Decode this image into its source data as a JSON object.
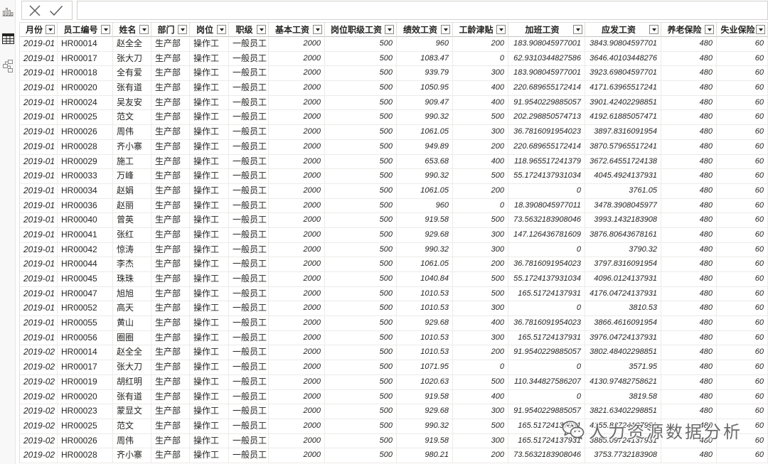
{
  "sidebar": {
    "items": [
      {
        "icon": "report-view-icon",
        "selected": false
      },
      {
        "icon": "data-view-icon",
        "selected": true
      },
      {
        "icon": "model-view-icon",
        "selected": false
      }
    ]
  },
  "formula_bar": {
    "cancel_icon": "close-icon",
    "commit_icon": "check-icon",
    "value": ""
  },
  "table": {
    "columns": [
      {
        "label": "月份"
      },
      {
        "label": "员工编号"
      },
      {
        "label": "姓名"
      },
      {
        "label": "部门"
      },
      {
        "label": "岗位"
      },
      {
        "label": "职级"
      },
      {
        "label": "基本工资"
      },
      {
        "label": "岗位职级工资"
      },
      {
        "label": "绩效工资"
      },
      {
        "label": "工龄津贴"
      },
      {
        "label": "加班工资"
      },
      {
        "label": "应发工资"
      },
      {
        "label": "养老保险"
      },
      {
        "label": "失业保险"
      }
    ],
    "rows": [
      [
        "2019-01",
        "HR00014",
        "赵全全",
        "生产部",
        "操作工",
        "一般员工",
        2000,
        500,
        960,
        200,
        183.908045977001,
        3843.90804597701,
        480,
        60
      ],
      [
        "2019-01",
        "HR00017",
        "张大刀",
        "生产部",
        "操作工",
        "一般员工",
        2000,
        500,
        1083.47,
        0,
        62.9310344827586,
        3646.40103448276,
        480,
        60
      ],
      [
        "2019-01",
        "HR00018",
        "全有爱",
        "生产部",
        "操作工",
        "一般员工",
        2000,
        500,
        939.79,
        300,
        183.908045977001,
        3923.69804597701,
        480,
        60
      ],
      [
        "2019-01",
        "HR00020",
        "张有道",
        "生产部",
        "操作工",
        "一般员工",
        2000,
        500,
        1050.95,
        400,
        220.689655172414,
        4171.63965517241,
        480,
        60
      ],
      [
        "2019-01",
        "HR00024",
        "吴友安",
        "生产部",
        "操作工",
        "一般员工",
        2000,
        500,
        909.47,
        400,
        91.9540229885057,
        3901.42402298851,
        480,
        60
      ],
      [
        "2019-01",
        "HR00025",
        "范文",
        "生产部",
        "操作工",
        "一般员工",
        2000,
        500,
        990.32,
        500,
        202.298850574713,
        4192.61885057471,
        480,
        60
      ],
      [
        "2019-01",
        "HR00026",
        "周伟",
        "生产部",
        "操作工",
        "一般员工",
        2000,
        500,
        1061.05,
        300,
        36.7816091954023,
        3897.8316091954,
        480,
        60
      ],
      [
        "2019-01",
        "HR00028",
        "齐小寨",
        "生产部",
        "操作工",
        "一般员工",
        2000,
        500,
        949.89,
        200,
        220.689655172414,
        3870.57965517241,
        480,
        60
      ],
      [
        "2019-01",
        "HR00029",
        "施工",
        "生产部",
        "操作工",
        "一般员工",
        2000,
        500,
        653.68,
        400,
        118.965517241379,
        3672.64551724138,
        480,
        60
      ],
      [
        "2019-01",
        "HR00033",
        "万峰",
        "生产部",
        "操作工",
        "一般员工",
        2000,
        500,
        990.32,
        500,
        55.1724137931034,
        4045.4924137931,
        480,
        60
      ],
      [
        "2019-01",
        "HR00034",
        "赵娟",
        "生产部",
        "操作工",
        "一般员工",
        2000,
        500,
        1061.05,
        200,
        0,
        3761.05,
        480,
        60
      ],
      [
        "2019-01",
        "HR00036",
        "赵丽",
        "生产部",
        "操作工",
        "一般员工",
        2000,
        500,
        960,
        0,
        18.3908045977011,
        3478.3908045977,
        480,
        60
      ],
      [
        "2019-01",
        "HR00040",
        "曾英",
        "生产部",
        "操作工",
        "一般员工",
        2000,
        500,
        919.58,
        500,
        73.5632183908046,
        3993.1432183908,
        480,
        60
      ],
      [
        "2019-01",
        "HR00041",
        "张红",
        "生产部",
        "操作工",
        "一般员工",
        2000,
        500,
        929.68,
        300,
        147.126436781609,
        3876.80643678161,
        480,
        60
      ],
      [
        "2019-01",
        "HR00042",
        "惊涛",
        "生产部",
        "操作工",
        "一般员工",
        2000,
        500,
        990.32,
        300,
        0,
        3790.32,
        480,
        60
      ],
      [
        "2019-01",
        "HR00044",
        "李杰",
        "生产部",
        "操作工",
        "一般员工",
        2000,
        500,
        1061.05,
        200,
        36.7816091954023,
        3797.8316091954,
        480,
        60
      ],
      [
        "2019-01",
        "HR00045",
        "珠珠",
        "生产部",
        "操作工",
        "一般员工",
        2000,
        500,
        1040.84,
        500,
        55.1724137931034,
        4096.0124137931,
        480,
        60
      ],
      [
        "2019-01",
        "HR00047",
        "旭旭",
        "生产部",
        "操作工",
        "一般员工",
        2000,
        500,
        1010.53,
        500,
        165.51724137931,
        4176.04724137931,
        480,
        60
      ],
      [
        "2019-01",
        "HR00052",
        "高天",
        "生产部",
        "操作工",
        "一般员工",
        2000,
        500,
        1010.53,
        300,
        0,
        3810.53,
        480,
        60
      ],
      [
        "2019-01",
        "HR00055",
        "黄山",
        "生产部",
        "操作工",
        "一般员工",
        2000,
        500,
        929.68,
        400,
        36.7816091954023,
        3866.4616091954,
        480,
        60
      ],
      [
        "2019-01",
        "HR00056",
        "圈圈",
        "生产部",
        "操作工",
        "一般员工",
        2000,
        500,
        1010.53,
        300,
        165.51724137931,
        3976.04724137931,
        480,
        60
      ],
      [
        "2019-02",
        "HR00014",
        "赵全全",
        "生产部",
        "操作工",
        "一般员工",
        2000,
        500,
        1010.53,
        200,
        91.9540229885057,
        3802.48402298851,
        480,
        60
      ],
      [
        "2019-02",
        "HR00017",
        "张大刀",
        "生产部",
        "操作工",
        "一般员工",
        2000,
        500,
        1071.95,
        0,
        0,
        3571.95,
        480,
        60
      ],
      [
        "2019-02",
        "HR00019",
        "胡红明",
        "生产部",
        "操作工",
        "一般员工",
        2000,
        500,
        1020.63,
        500,
        110.344827586207,
        4130.97482758621,
        480,
        60
      ],
      [
        "2019-02",
        "HR00020",
        "张有道",
        "生产部",
        "操作工",
        "一般员工",
        2000,
        500,
        919.58,
        400,
        0,
        3819.58,
        480,
        60
      ],
      [
        "2019-02",
        "HR00023",
        "蒙显文",
        "生产部",
        "操作工",
        "一般员工",
        2000,
        500,
        929.68,
        300,
        91.9540229885057,
        3821.63402298851,
        480,
        60
      ],
      [
        "2019-02",
        "HR00025",
        "范文",
        "生产部",
        "操作工",
        "一般员工",
        2000,
        500,
        990.32,
        500,
        165.51724137931,
        4155.83724137931,
        480,
        60
      ],
      [
        "2019-02",
        "HR00026",
        "周伟",
        "生产部",
        "操作工",
        "一般员工",
        2000,
        500,
        919.58,
        300,
        165.51724137931,
        3885.09724137931,
        480,
        60
      ],
      [
        "2019-02",
        "HR00028",
        "齐小寨",
        "生产部",
        "操作工",
        "一般员工",
        2000,
        500,
        980.21,
        200,
        73.5632183908046,
        3753.7732183908,
        480,
        60
      ]
    ]
  },
  "watermark": {
    "icon": "wechat-icon",
    "text": "人力资源数据分析"
  },
  "colors": {
    "text": "#252423",
    "gridline": "#edebe9",
    "header_border": "#c8c6c4"
  }
}
